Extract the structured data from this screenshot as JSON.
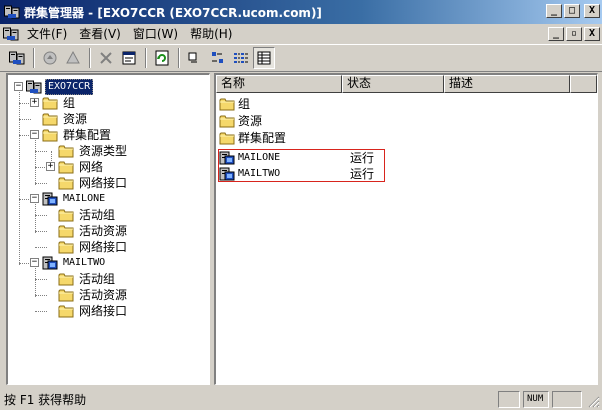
{
  "window": {
    "title": "群集管理器 - [EXO7CCR (EXO7CCR.ucom.com)]",
    "buttons": {
      "minimize": "_",
      "maximize": "□",
      "close": "X"
    },
    "mdi_buttons": {
      "minimize": "_",
      "restore": "▫",
      "close": "X"
    }
  },
  "menu": [
    "文件(F)",
    "查看(V)",
    "窗口(W)",
    "帮助(H)"
  ],
  "toolbar": {
    "buttons": [
      "open-connection-icon",
      "bring-online-icon",
      "take-offline-icon",
      "delete-icon",
      "properties-icon",
      "refresh-icon",
      "large-icons-icon",
      "small-icons-icon",
      "list-view-icon",
      "details-view-icon"
    ]
  },
  "tree": {
    "root": "EXO7CCR",
    "groups": "组",
    "resources": "资源",
    "cluster_config": "群集配置",
    "resource_types": "资源类型",
    "networks": "网络",
    "network_interfaces": "网络接口",
    "node1": {
      "name": "MAILONE",
      "active_groups": "活动组",
      "active_resources": "活动资源",
      "network_interfaces": "网络接口"
    },
    "node2": {
      "name": "MAILTWO",
      "active_groups": "活动组",
      "active_resources": "活动资源",
      "network_interfaces": "网络接口"
    }
  },
  "list": {
    "columns": [
      "名称",
      "状态",
      "描述"
    ],
    "rows": [
      {
        "name": "组",
        "state": ""
      },
      {
        "name": "资源",
        "state": ""
      },
      {
        "name": "群集配置",
        "state": ""
      },
      {
        "name": "MAILONE",
        "state": "运行"
      },
      {
        "name": "MAILTWO",
        "state": "运行"
      }
    ]
  },
  "status": {
    "text": "按 F1 获得帮助",
    "num": "NUM"
  },
  "colors": {
    "titlebar_start": "#0a246a",
    "selection": "#0a246a",
    "highlight_box": "#d8241d",
    "folder": "#f5d86b"
  }
}
